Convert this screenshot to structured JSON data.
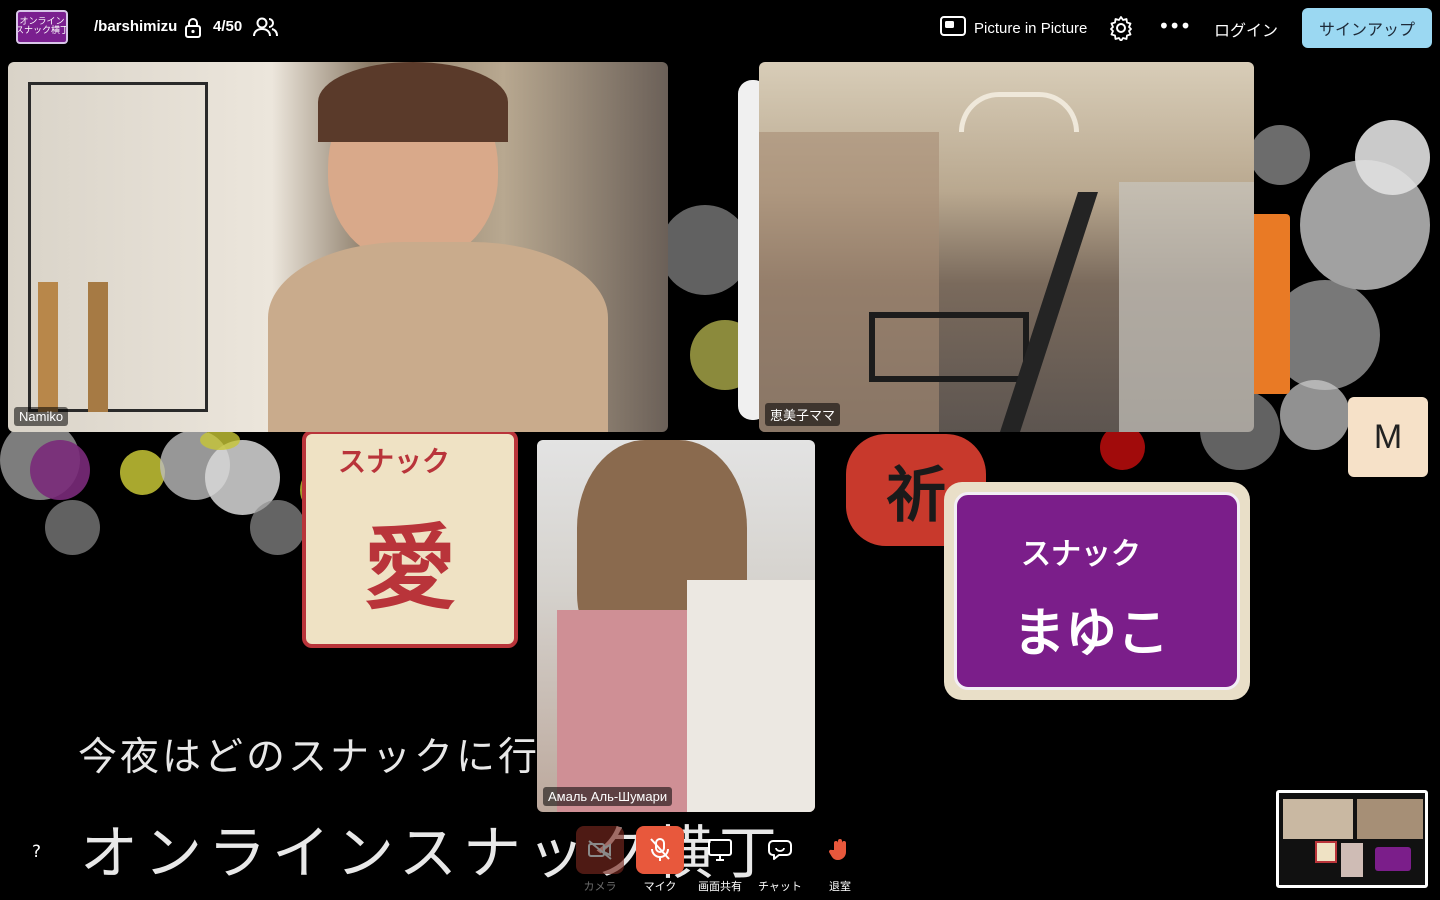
{
  "app": {
    "logo_text": "オンライン\nスナック横丁",
    "room_name": "/barshimizu",
    "participant_count": "4/50"
  },
  "header": {
    "pip_label": "Picture in Picture",
    "more_label": "•••",
    "login_label": "ログイン",
    "signup_label": "サインアップ"
  },
  "tiles": {
    "namiko": {
      "label": "Namiko"
    },
    "emiko": {
      "label": "恵美子ママ"
    },
    "amal": {
      "label": "Амаль Аль-Шумари"
    },
    "m_avatar": {
      "initial": "M"
    }
  },
  "background": {
    "sub_title": "今夜はどのスナックに行",
    "main_title": "オンラインスナック横丁",
    "sign_ai_top": "スナック",
    "sign_ai_main": "愛",
    "sign_inori": "祈",
    "sign_mayuko_top": "スナック",
    "sign_mayuko_main": "まゆこ"
  },
  "controls": {
    "help_label": "?",
    "camera_label": "カメラ",
    "mic_label": "マイク",
    "screen_share_label": "画面共有",
    "chat_label": "チャット",
    "leave_label": "退室"
  },
  "colors": {
    "signup_bg": "#9bd8f2",
    "mic_muted": "#e8583c",
    "logo_purple": "#7a1f8f",
    "sign_purple": "#7b1e8a"
  },
  "icons": {
    "lock": "lock-icon",
    "people": "people-icon",
    "pip": "picture-in-picture-icon",
    "settings": "gear-icon",
    "more": "more-icon",
    "camera": "camera-off-icon",
    "mic": "mic-off-icon",
    "screen": "monitor-icon",
    "chat": "chat-icon",
    "leave": "wave-hand-icon"
  }
}
